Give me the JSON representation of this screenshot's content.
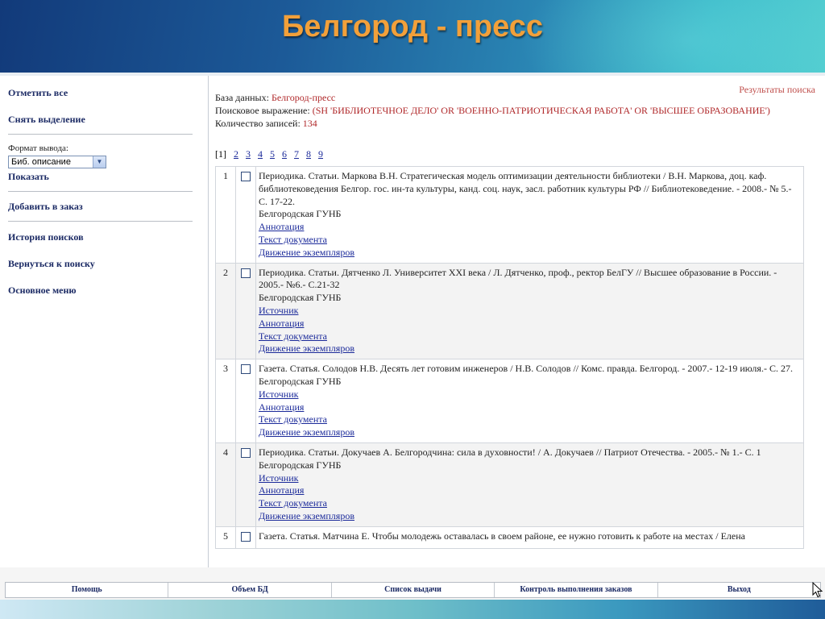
{
  "header": {
    "title": "Белгород - пресс"
  },
  "sidebar": {
    "mark_all": "Отметить все",
    "unselect": "Снять выделение",
    "format_label": "Формат вывода:",
    "format_value": "Биб. описание",
    "show": "Показать",
    "add_to_order": "Добавить в заказ",
    "search_history": "История поисков",
    "back_to_search": "Вернуться к поиску",
    "main_menu": "Основное меню"
  },
  "main": {
    "results_label": "Результаты поиска",
    "db_label": "База данных:",
    "db_value": "Белгород-пресс",
    "query_label": "Поисковое выражение:",
    "query_value": "(SH 'БИБЛИОТЕЧНОЕ ДЕЛО' OR 'ВОЕННО-ПАТРИОТИЧЕСКАЯ РАБОТА' OR 'ВЫСШЕЕ ОБРАЗОВАНИЕ')",
    "count_label": "Количество записей:",
    "count_value": "134",
    "pager": {
      "current": "[1]",
      "pages": [
        "2",
        "3",
        "4",
        "5",
        "6",
        "7",
        "8",
        "9"
      ]
    },
    "records": [
      {
        "num": "1",
        "text": "Периодика. Статьи. Маркова В.Н. Стратегическая модель оптимизации деятельности библиотеки / В.Н. Маркова, доц. каф. библиотековедения Белгор. гос. ин-та культуры, канд. соц. наук, засл. работник культуры РФ // Библиотековедение. - 2008.- № 5.- С. 17-22.",
        "holder": "Белгородская ГУНБ",
        "links": [
          "Аннотация",
          "Текст документа",
          "Движение экземпляров"
        ]
      },
      {
        "num": "2",
        "text": "Периодика. Статьи. Дятченко Л. Университет XXI века / Л. Дятченко, проф., ректор БелГУ // Высшее образование в России. - 2005.- №6.- С.21-32",
        "holder": "Белгородская ГУНБ",
        "links": [
          "Источник",
          "Аннотация",
          "Текст документа",
          "Движение экземпляров"
        ]
      },
      {
        "num": "3",
        "text": "Газета. Статья. Солодов Н.В. Десять лет готовим инженеров / Н.В. Солодов // Комс. правда. Белгород. - 2007.- 12-19 июля.- С. 27.",
        "holder": "Белгородская ГУНБ",
        "links": [
          "Источник",
          "Аннотация",
          "Текст документа",
          "Движение экземпляров"
        ]
      },
      {
        "num": "4",
        "text": "Периодика. Статьи. Докучаев А. Белгородчина: сила в духовности! / А. Докучаев // Патриот Отечества. - 2005.- № 1.- С. 1",
        "holder": "Белгородская ГУНБ",
        "links": [
          "Источник",
          "Аннотация",
          "Текст документа",
          "Движение экземпляров"
        ]
      },
      {
        "num": "5",
        "text": "Газета. Статья. Матчина Е. Чтобы молодежь оставалась в своем районе, ее нужно готовить к работе на местах / Елена",
        "holder": "",
        "links": []
      }
    ]
  },
  "footer": {
    "items": [
      "Помощь",
      "Объем БД",
      "Список выдачи",
      "Контроль выполнения заказов",
      "Выход"
    ]
  },
  "colors": {
    "title_orange": "#f2a03a",
    "link_navy": "#1b2a64",
    "value_red": "#b0282a"
  },
  "icons": {
    "dropdown": "chevron-down-icon",
    "cursor": "mouse-pointer-icon"
  }
}
